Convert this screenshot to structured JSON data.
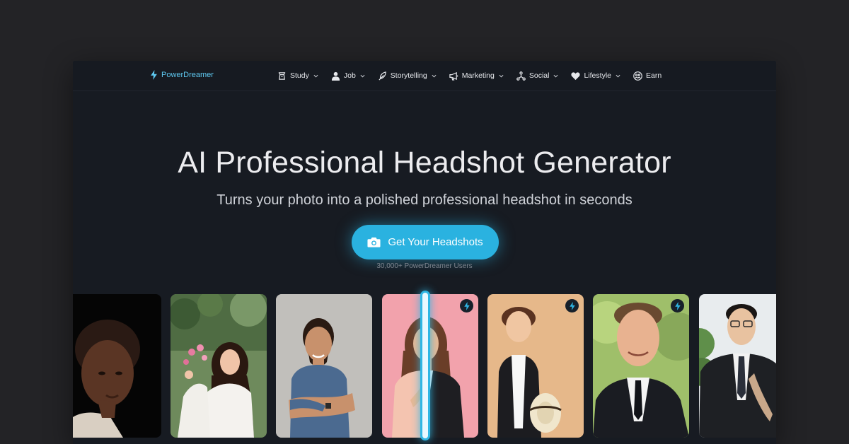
{
  "brand": {
    "name": "PowerDreamer",
    "icon": "lightning-icon"
  },
  "nav": [
    {
      "label": "Study",
      "icon": "study-icon",
      "has_dropdown": true
    },
    {
      "label": "Job",
      "icon": "user-icon",
      "has_dropdown": true
    },
    {
      "label": "Storytelling",
      "icon": "feather-icon",
      "has_dropdown": true
    },
    {
      "label": "Marketing",
      "icon": "megaphone-icon",
      "has_dropdown": true
    },
    {
      "label": "Social",
      "icon": "network-icon",
      "has_dropdown": true
    },
    {
      "label": "Lifestyle",
      "icon": "heart-icon",
      "has_dropdown": true
    },
    {
      "label": "Earn",
      "icon": "people-icon",
      "has_dropdown": false
    }
  ],
  "hero": {
    "title": "AI Professional Headshot Generator",
    "subtitle": "Turns your photo into a polished professional headshot in seconds",
    "cta_label": "Get Your Headshots",
    "cta_icon": "camera-icon",
    "users_note": "30,000+ PowerDreamer Users"
  },
  "gallery": [
    {
      "name": "woman-braids-portrait",
      "ai_badge": false
    },
    {
      "name": "woman-white-dress-flowers",
      "ai_badge": false
    },
    {
      "name": "man-blue-tshirt-arms-crossed",
      "ai_badge": false
    },
    {
      "name": "woman-before-after-suit",
      "ai_badge": true
    },
    {
      "name": "man-curly-hair-hat",
      "ai_badge": true
    },
    {
      "name": "man-suit-green-background",
      "ai_badge": true
    },
    {
      "name": "man-glasses-suit",
      "ai_badge": false
    }
  ],
  "colors": {
    "accent": "#2ab2e0",
    "brand": "#5ec8f0",
    "window_bg": "#171b22",
    "page_bg": "#232326"
  }
}
